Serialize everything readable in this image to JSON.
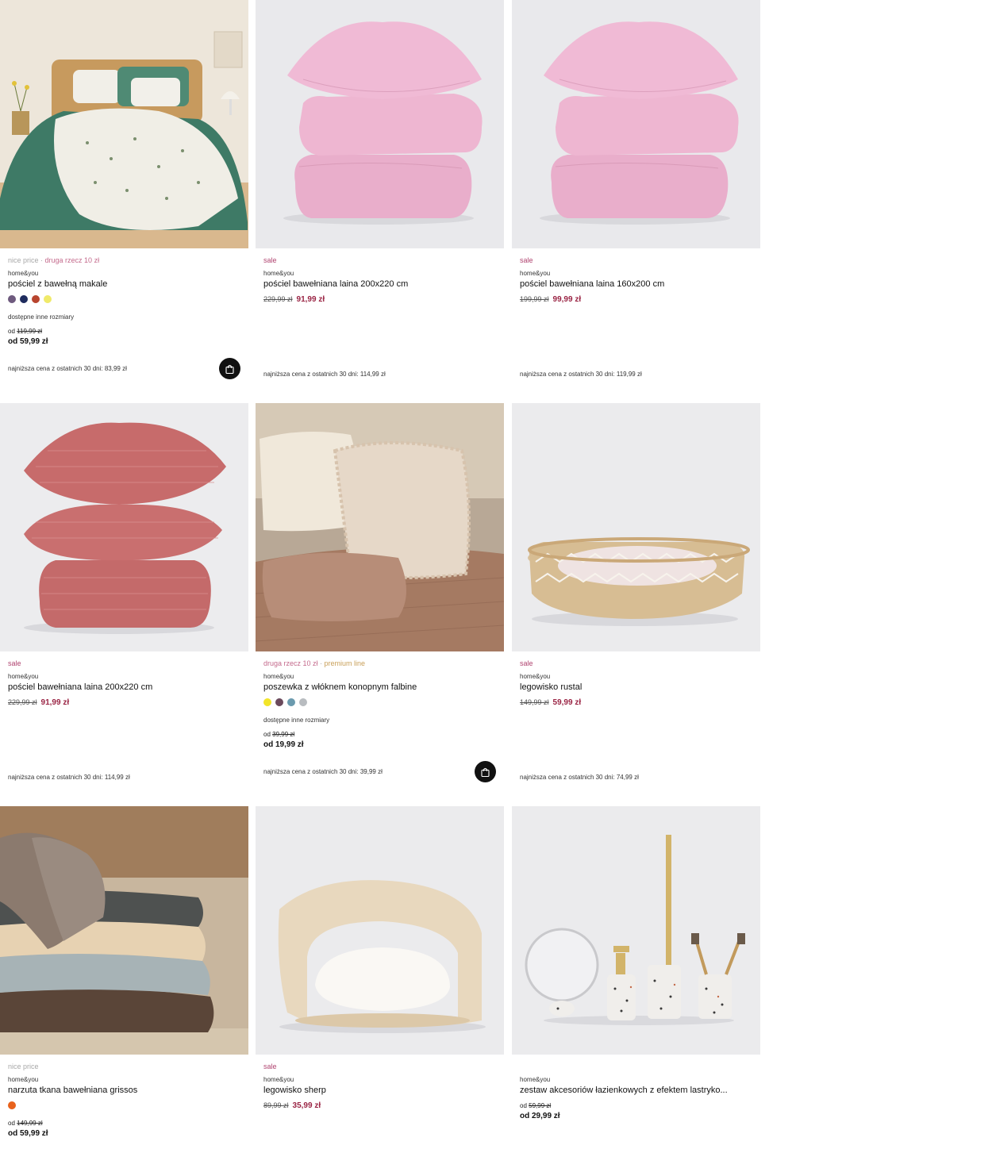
{
  "products": [
    {
      "tag_parts": [
        {
          "text": "nice price",
          "tone": "grey"
        },
        {
          "text": " · ",
          "tone": "grey"
        },
        {
          "text": "druga rzecz 10 zł",
          "tone": "pink"
        }
      ],
      "brand": "home&you",
      "name": "pościel z bawełną makale",
      "swatches": [
        "#6e5a7e",
        "#1f2c5e",
        "#b8452f",
        "#f0ea6a"
      ],
      "more_sizes": "dostępne inne rozmiary",
      "price_old_prefix": "od",
      "price_old": "119,99 zł",
      "price_new": "od 59,99 zł",
      "lowest": "najniższa cena z ostatnich 30 dni: 83,99 zł",
      "cart_icon": "shopping-bag-icon"
    },
    {
      "tag_parts": [
        {
          "text": "sale",
          "tone": "b"
        }
      ],
      "brand": "home&you",
      "name": "pościel bawełniana laina 200x220 cm",
      "sale_old": "229,99 zł",
      "sale_new": "91,99 zł",
      "lowest": "najniższa cena z ostatnich 30 dni: 114,99 zł"
    },
    {
      "tag_parts": [
        {
          "text": "sale",
          "tone": "b"
        }
      ],
      "brand": "home&you",
      "name": "pościel bawełniana laina 160x200 cm",
      "sale_old": "199,99 zł",
      "sale_new": "99,99 zł",
      "lowest": "najniższa cena z ostatnich 30 dni: 119,99 zł"
    },
    {
      "tag_parts": [
        {
          "text": "sale",
          "tone": "b"
        }
      ],
      "brand": "home&you",
      "name": "pościel bawełniana laina 200x220 cm",
      "sale_old": "229,99 zł",
      "sale_new": "91,99 zł",
      "lowest": "najniższa cena z ostatnich 30 dni: 114,99 zł"
    },
    {
      "tag_parts": [
        {
          "text": "druga rzecz 10 zł",
          "tone": "pink"
        },
        {
          "text": " · ",
          "tone": "grey"
        },
        {
          "text": "premium line",
          "tone": "gold"
        }
      ],
      "brand": "home&you",
      "name": "poszewka z włóknem konopnym falbine",
      "swatches": [
        "#f2e52a",
        "#6b4a5c",
        "#6b9aae",
        "#b8bcc0"
      ],
      "more_sizes": "dostępne inne rozmiary",
      "price_old_prefix": "od",
      "price_old": "39,99 zł",
      "price_new": "od 19,99 zł",
      "lowest": "najniższa cena z ostatnich 30 dni: 39,99 zł",
      "cart_icon": "shopping-bag-icon"
    },
    {
      "tag_parts": [
        {
          "text": "sale",
          "tone": "b"
        }
      ],
      "brand": "home&you",
      "name": "legowisko rustal",
      "sale_old": "149,99 zł",
      "sale_new": "59,99 zł",
      "lowest": "najniższa cena z ostatnich 30 dni: 74,99 zł"
    },
    {
      "tag_parts": [
        {
          "text": "nice price",
          "tone": "grey"
        }
      ],
      "brand": "home&you",
      "name": "narzuta tkana bawełniana grissos",
      "swatches": [
        "#e8621c"
      ],
      "price_old_prefix": "od",
      "price_old": "149,99 zł",
      "price_new": "od 59,99 zł"
    },
    {
      "tag_parts": [
        {
          "text": "sale",
          "tone": "b"
        }
      ],
      "brand": "home&you",
      "name": "legowisko sherp",
      "sale_old": "89,99 zł",
      "sale_new": "35,99 zł"
    },
    {
      "tag_parts": [],
      "brand": "home&you",
      "name": "zestaw akcesoriów łazienkowych z efektem lastryko...",
      "price_old_prefix": "od",
      "price_old": "59,99 zł",
      "price_new": "od 29,99 zł"
    }
  ],
  "colors": {
    "sale_red": "#9a2444",
    "tag_pink": "#b04470",
    "cart_button": "#111111"
  }
}
